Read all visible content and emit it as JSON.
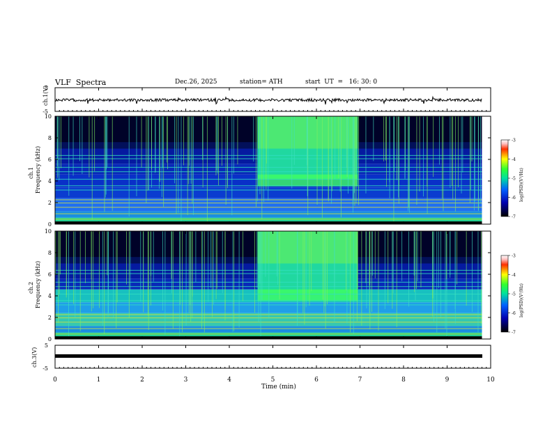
{
  "header": {
    "title": "VLF  Spectra",
    "date": "Dec.26, 2025",
    "station": "station= ATH",
    "start": "start  UT  =   16: 30: 0"
  },
  "chart_data": [
    {
      "type": "line",
      "name": "ch1-timeseries",
      "ylabel": "ch.1(V)",
      "ylim": [
        -5,
        5
      ],
      "yticks": [
        "5",
        "-5"
      ],
      "description_level": -0.2
    },
    {
      "type": "heatmap",
      "name": "ch1-spectrogram",
      "ylabel_line1": "ch.1",
      "ylabel_line2": "Frequency  (kHz)",
      "ylim": [
        0,
        10
      ],
      "yticks": [
        "0",
        "2",
        "4",
        "6",
        "8",
        "10"
      ],
      "xlim": [
        0,
        9.8
      ],
      "burst_interval_min": [
        4.65,
        6.95
      ],
      "colorbar": {
        "label": "log(PSD)(V²/Hz)",
        "range": [
          -7,
          -3
        ],
        "ticks": [
          "-3",
          "-4",
          "-5",
          "-6",
          "-7"
        ]
      }
    },
    {
      "type": "heatmap",
      "name": "ch2-spectrogram",
      "ylabel_line1": "ch.2",
      "ylabel_line2": "Frequency  (kHz)",
      "ylim": [
        0,
        10
      ],
      "yticks": [
        "0",
        "2",
        "4",
        "6",
        "8",
        "10"
      ],
      "xlim": [
        0,
        9.8
      ],
      "burst_interval_min": [
        4.65,
        6.95
      ],
      "colorbar": {
        "label": "log(PSD)(V²/Hz)",
        "range": [
          -7,
          -3
        ],
        "ticks": [
          "-3",
          "-4",
          "-5",
          "-6",
          "-7"
        ]
      }
    },
    {
      "type": "line",
      "name": "ch3-timeseries",
      "ylabel": "ch.3(V)",
      "ylim": [
        -5,
        5
      ],
      "yticks": [
        "5",
        "-5"
      ],
      "level": -0.3
    }
  ],
  "xaxis": {
    "label": "Time  (min)",
    "range": [
      0,
      10
    ],
    "ticks": [
      "0",
      "1",
      "2",
      "3",
      "4",
      "5",
      "6",
      "7",
      "8",
      "9",
      "10"
    ]
  },
  "colors": {
    "low": "#000000",
    "mid": "#0030c0",
    "accent": "#19e39b",
    "high": "#ff0000"
  }
}
